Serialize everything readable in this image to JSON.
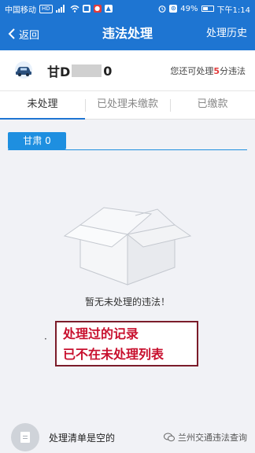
{
  "status_bar": {
    "carrier": "中国移动",
    "network_badge": "HD",
    "battery_percent": "49%",
    "time": "下午1:14"
  },
  "nav": {
    "back_label": "返回",
    "title": "违法处理",
    "history_label": "处理历史"
  },
  "vehicle": {
    "plate_prefix": "甘D",
    "plate_suffix": "0",
    "quota_prefix": "您还可处理",
    "quota_number": "5",
    "quota_suffix": "分违法"
  },
  "tabs": [
    {
      "label": "未处理",
      "active": true
    },
    {
      "label": "已处理未缴款",
      "active": false
    },
    {
      "label": "已缴款",
      "active": false
    }
  ],
  "region_chip": "甘肃 0",
  "empty_message": "暂无未处理的违法！",
  "annotation": {
    "bullet": "·",
    "line1": "处理过的记录",
    "line2": "已不在未处理列表"
  },
  "bottom": {
    "list_label": "处理清单是空的",
    "watermark": "兰州交通违法查询"
  },
  "colors": {
    "primary": "#1e75d2",
    "chip": "#1e8fe0",
    "highlight_red": "#e23b3b",
    "annotation_border": "#7b1c2a",
    "annotation_text": "#c8102e"
  }
}
